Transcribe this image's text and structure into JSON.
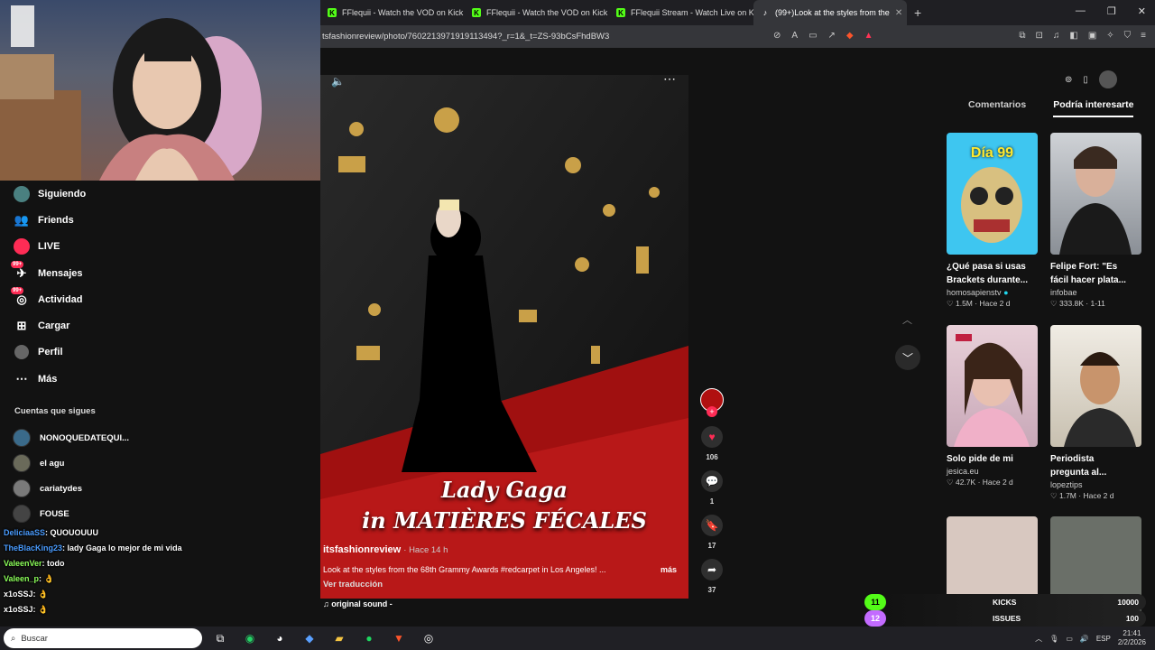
{
  "browser": {
    "tabs": [
      {
        "label": "FFlequii - Watch the VOD on Kick",
        "icon": "kick-icon"
      },
      {
        "label": "FFlequii - Watch the VOD on Kick",
        "icon": "kick-icon"
      },
      {
        "label": "FFlequii Stream - Watch Live on Kick",
        "icon": "kick-icon"
      },
      {
        "label": "(99+)Look at the styles from the",
        "icon": "tiktok-icon",
        "active": true
      }
    ],
    "url": "tsfashionreview/photo/7602213971919113494?_r=1&_t=ZS-93bCsFhdBW3"
  },
  "sidebar": {
    "nav": [
      {
        "label": "Siguiendo",
        "icon": "following-icon"
      },
      {
        "label": "Friends",
        "icon": "friends-icon"
      },
      {
        "label": "LIVE",
        "icon": "live-icon"
      },
      {
        "label": "Mensajes",
        "icon": "messages-icon",
        "badge": "99+"
      },
      {
        "label": "Actividad",
        "icon": "activity-icon",
        "badge": "99+"
      },
      {
        "label": "Cargar",
        "icon": "upload-icon"
      },
      {
        "label": "Perfil",
        "icon": "profile-icon"
      },
      {
        "label": "Más",
        "icon": "more-icon"
      }
    ],
    "following_title": "Cuentas que sigues",
    "following": [
      "NONOQUEDATEQUI...",
      "el agu",
      "cariatydes",
      "FOUSE"
    ]
  },
  "chat": [
    {
      "user": "DeliciaaSS",
      "text": ": QUOUOUUU",
      "color": "#4a9cff"
    },
    {
      "user": "TheBlacKing23",
      "text": ": lady Gaga lo mejor de mi vida",
      "color": "#4a9cff"
    },
    {
      "user": "ValeenVer",
      "text": ": todo",
      "color": "#8cff5a"
    },
    {
      "user": "Valeen_p",
      "text": ": 👌",
      "color": "#8cff5a"
    },
    {
      "user": "x1oSSJ",
      "text": ": 👌",
      "color": "#ffffff"
    },
    {
      "user": "x1oSSJ",
      "text": ": 👌",
      "color": "#ffffff"
    }
  ],
  "post": {
    "overlay_line1": "Lady Gaga",
    "overlay_line2": "in MATIÈRES FÉCALES",
    "author": "itsfashionreview",
    "time": "· Hace 14 h",
    "caption": "Look at the styles from the 68th Grammy Awards #redcarpet in Los Angeles! ...",
    "more": "más",
    "translate": "Ver traducción",
    "sound": "original sound - ",
    "likes": "106",
    "comments": "1",
    "saves": "17",
    "shares": "37"
  },
  "right_panel": {
    "tabs": [
      "Comentarios",
      "Podría interesarte"
    ],
    "cards": [
      {
        "title1": "¿Qué pasa si usas",
        "title2": "Brackets durante...",
        "author": "homosapienstv",
        "verified": true,
        "likes": "1.5M",
        "age": "Hace 2 d",
        "thumb_text": "Día 99"
      },
      {
        "title1": "Felipe Fort: \"Es",
        "title2": "fácil hacer plata...",
        "author": "infobae",
        "verified": false,
        "likes": "333.8K",
        "age": "1-11",
        "thumb_text": ""
      },
      {
        "title1": "Solo pide de mi",
        "title2": "",
        "author": "jesica.eu",
        "verified": false,
        "likes": "42.7K",
        "age": "Hace 2 d",
        "thumb_text": ""
      },
      {
        "title1": "Periodista",
        "title2": "pregunta al...",
        "author": "lopeztips",
        "verified": false,
        "likes": "1.7M",
        "age": "Hace 2 d",
        "thumb_text": ""
      }
    ]
  },
  "stream_overlay": {
    "bar1": {
      "level": "11",
      "label": "KICKS",
      "value": "10000"
    },
    "bar2": {
      "level": "12",
      "label": "ISSUES",
      "value": "100"
    }
  },
  "taskbar": {
    "search": "Buscar",
    "lang": "ESP",
    "time": "21:41",
    "date": "2/2/2026"
  },
  "colors": {
    "accent": "#fe2c55",
    "kick": "#53fc18"
  }
}
